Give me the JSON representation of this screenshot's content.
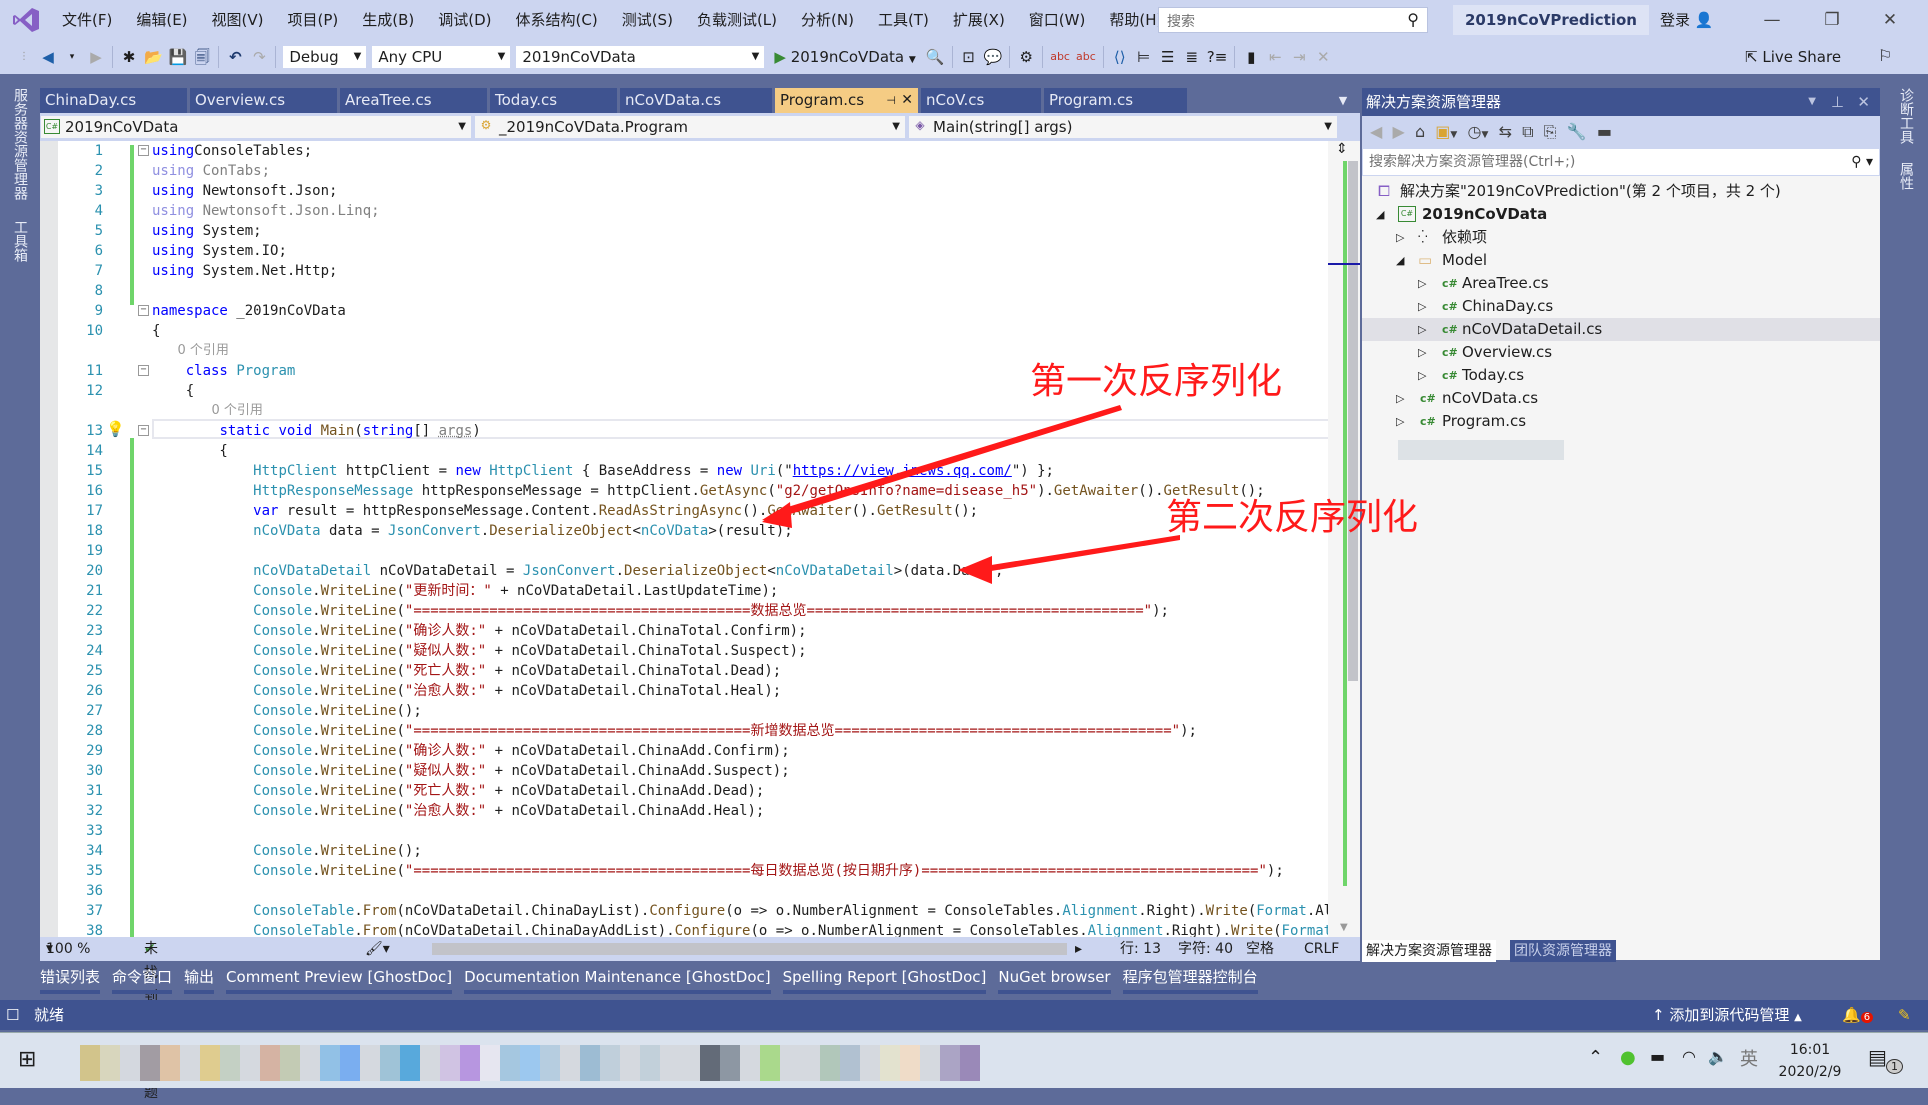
{
  "titlebar": {
    "menus": [
      "文件(F)",
      "编辑(E)",
      "视图(V)",
      "项目(P)",
      "生成(B)",
      "调试(D)",
      "体系结构(C)",
      "测试(S)",
      "负载测试(L)",
      "分析(N)",
      "工具(T)",
      "扩展(X)",
      "窗口(W)",
      "帮助(H)"
    ],
    "search_placeholder": "搜索",
    "solution_name": "2019nCoVPrediction",
    "login": "登录"
  },
  "toolbar": {
    "config": "Debug",
    "platform": "Any CPU",
    "startup_project": "2019nCoVData",
    "run_label": "2019nCoVData",
    "live_share": "Live Share"
  },
  "left_strip": {
    "items": [
      "服务器资源管理器",
      "工具箱"
    ]
  },
  "right_strip": {
    "items": [
      "诊断工具",
      "属性"
    ]
  },
  "tabs": [
    {
      "label": "ChinaDay.cs",
      "active": false
    },
    {
      "label": "Overview.cs",
      "active": false
    },
    {
      "label": "AreaTree.cs",
      "active": false
    },
    {
      "label": "Today.cs",
      "active": false
    },
    {
      "label": "nCoVData.cs",
      "active": false
    },
    {
      "label": "Program.cs",
      "active": true
    },
    {
      "label": "nCoV.cs",
      "active": false
    },
    {
      "label": "Program.cs",
      "active": false
    }
  ],
  "navbar": {
    "project": "2019nCoVData",
    "type": "_2019nCoVData.Program",
    "member": "Main(string[] args)"
  },
  "editor": {
    "lines": [
      {
        "n": "1",
        "tokens": [
          [
            "kw",
            "using"
          ],
          [
            "",
            "ConsoleTables;"
          ]
        ]
      },
      {
        "n": "2",
        "tokens": [
          [
            "gk",
            "using"
          ],
          [
            "gr",
            " ConTabs;"
          ]
        ]
      },
      {
        "n": "3",
        "tokens": [
          [
            "kw",
            "using"
          ],
          [
            "",
            " Newtonsoft.Json;"
          ]
        ]
      },
      {
        "n": "4",
        "tokens": [
          [
            "gk",
            "using"
          ],
          [
            "gr",
            " Newtonsoft.Json.Linq;"
          ]
        ]
      },
      {
        "n": "5",
        "tokens": [
          [
            "kw",
            "using"
          ],
          [
            "",
            " System;"
          ]
        ]
      },
      {
        "n": "6",
        "tokens": [
          [
            "kw",
            "using"
          ],
          [
            "",
            " System.IO;"
          ]
        ]
      },
      {
        "n": "7",
        "tokens": [
          [
            "kw",
            "using"
          ],
          [
            "",
            " System.Net.Http;"
          ]
        ]
      },
      {
        "n": "8",
        "tokens": []
      },
      {
        "n": "9",
        "tokens": [
          [
            "kw",
            "namespace"
          ],
          [
            "",
            " _2019nCoVData"
          ]
        ]
      },
      {
        "n": "10",
        "tokens": [
          [
            "",
            "{"
          ]
        ]
      },
      {
        "lens": "0 个引用",
        "indent": 3
      },
      {
        "n": "11",
        "tokens": [
          [
            "",
            "    "
          ],
          [
            "kw",
            "class"
          ],
          [
            "",
            " "
          ],
          [
            "ty",
            "Program"
          ]
        ]
      },
      {
        "n": "12",
        "tokens": [
          [
            "",
            "    {"
          ]
        ]
      },
      {
        "lens": "0 个引用",
        "indent": 7
      },
      {
        "n": "13",
        "tokens": [
          [
            "",
            "        "
          ],
          [
            "kw",
            "static void"
          ],
          [
            "",
            " "
          ],
          [
            "fn",
            "Main"
          ],
          [
            "",
            "("
          ],
          [
            "kw",
            "string"
          ],
          [
            "",
            "[] "
          ],
          [
            "pm",
            "args"
          ],
          [
            "",
            ")"
          ]
        ]
      },
      {
        "n": "14",
        "tokens": [
          [
            "",
            "        {"
          ]
        ]
      },
      {
        "n": "15",
        "tokens": [
          [
            "",
            "            "
          ],
          [
            "ty",
            "HttpClient"
          ],
          [
            "",
            " httpClient = "
          ],
          [
            "kw",
            "new"
          ],
          [
            "",
            " "
          ],
          [
            "ty",
            "HttpClient"
          ],
          [
            "",
            " { BaseAddress = "
          ],
          [
            "kw",
            "new"
          ],
          [
            "",
            " "
          ],
          [
            "ty",
            "Uri"
          ],
          [
            "",
            "(\""
          ],
          [
            "url",
            "https://view.inews.qq.com/"
          ],
          [
            "",
            "\") };"
          ]
        ]
      },
      {
        "n": "16",
        "tokens": [
          [
            "",
            "            "
          ],
          [
            "ty",
            "HttpResponseMessage"
          ],
          [
            "",
            " httpResponseMessage = httpClient."
          ],
          [
            "fn",
            "GetAsync"
          ],
          [
            "",
            "("
          ],
          [
            "st",
            "\"g2/getOnsInfo?name=disease_h5\""
          ],
          [
            "",
            ")."
          ],
          [
            "fn",
            "GetAwaiter"
          ],
          [
            "",
            "()."
          ],
          [
            "fn",
            "GetResult"
          ],
          [
            "",
            "();"
          ]
        ]
      },
      {
        "n": "17",
        "tokens": [
          [
            "",
            "            "
          ],
          [
            "kw",
            "var"
          ],
          [
            "",
            " result = httpResponseMessage.Content."
          ],
          [
            "fn",
            "ReadAsStringAsync"
          ],
          [
            "",
            "()."
          ],
          [
            "fn",
            "GetAwaiter"
          ],
          [
            "",
            "()."
          ],
          [
            "fn",
            "GetResult"
          ],
          [
            "",
            "();"
          ]
        ]
      },
      {
        "n": "18",
        "tokens": [
          [
            "",
            "            "
          ],
          [
            "ty",
            "nCoVData"
          ],
          [
            "",
            " data = "
          ],
          [
            "ty",
            "JsonConvert"
          ],
          [
            "",
            "."
          ],
          [
            "fn",
            "DeserializeObject"
          ],
          [
            "",
            "<"
          ],
          [
            "ty",
            "nCoVData"
          ],
          [
            "",
            ">(result);"
          ]
        ]
      },
      {
        "n": "19",
        "tokens": []
      },
      {
        "n": "20",
        "tokens": [
          [
            "",
            "            "
          ],
          [
            "ty",
            "nCoVDataDetail"
          ],
          [
            "",
            " nCoVDataDetail = "
          ],
          [
            "ty",
            "JsonConvert"
          ],
          [
            "",
            "."
          ],
          [
            "fn",
            "DeserializeObject"
          ],
          [
            "",
            "<"
          ],
          [
            "ty",
            "nCoVDataDetail"
          ],
          [
            "",
            ">(data.Data);"
          ]
        ]
      },
      {
        "n": "21",
        "tokens": [
          [
            "",
            "            "
          ],
          [
            "ty",
            "Console"
          ],
          [
            "",
            "."
          ],
          [
            "fn",
            "WriteLine"
          ],
          [
            "",
            "("
          ],
          [
            "st",
            "\"更新时间：\""
          ],
          [
            "",
            " + nCoVDataDetail.LastUpdateTime);"
          ]
        ]
      },
      {
        "n": "22",
        "tokens": [
          [
            "",
            "            "
          ],
          [
            "ty",
            "Console"
          ],
          [
            "",
            "."
          ],
          [
            "fn",
            "WriteLine"
          ],
          [
            "",
            "("
          ],
          [
            "st",
            "\"========================================数据总览========================================\""
          ],
          [
            "",
            ");"
          ]
        ]
      },
      {
        "n": "23",
        "tokens": [
          [
            "",
            "            "
          ],
          [
            "ty",
            "Console"
          ],
          [
            "",
            "."
          ],
          [
            "fn",
            "WriteLine"
          ],
          [
            "",
            "("
          ],
          [
            "st",
            "\"确诊人数:\""
          ],
          [
            "",
            " + nCoVDataDetail.ChinaTotal.Confirm);"
          ]
        ]
      },
      {
        "n": "24",
        "tokens": [
          [
            "",
            "            "
          ],
          [
            "ty",
            "Console"
          ],
          [
            "",
            "."
          ],
          [
            "fn",
            "WriteLine"
          ],
          [
            "",
            "("
          ],
          [
            "st",
            "\"疑似人数:\""
          ],
          [
            "",
            " + nCoVDataDetail.ChinaTotal.Suspect);"
          ]
        ]
      },
      {
        "n": "25",
        "tokens": [
          [
            "",
            "            "
          ],
          [
            "ty",
            "Console"
          ],
          [
            "",
            "."
          ],
          [
            "fn",
            "WriteLine"
          ],
          [
            "",
            "("
          ],
          [
            "st",
            "\"死亡人数:\""
          ],
          [
            "",
            " + nCoVDataDetail.ChinaTotal.Dead);"
          ]
        ]
      },
      {
        "n": "26",
        "tokens": [
          [
            "",
            "            "
          ],
          [
            "ty",
            "Console"
          ],
          [
            "",
            "."
          ],
          [
            "fn",
            "WriteLine"
          ],
          [
            "",
            "("
          ],
          [
            "st",
            "\"治愈人数:\""
          ],
          [
            "",
            " + nCoVDataDetail.ChinaTotal.Heal);"
          ]
        ]
      },
      {
        "n": "27",
        "tokens": [
          [
            "",
            "            "
          ],
          [
            "ty",
            "Console"
          ],
          [
            "",
            "."
          ],
          [
            "fn",
            "WriteLine"
          ],
          [
            "",
            "();"
          ]
        ]
      },
      {
        "n": "28",
        "tokens": [
          [
            "",
            "            "
          ],
          [
            "ty",
            "Console"
          ],
          [
            "",
            "."
          ],
          [
            "fn",
            "WriteLine"
          ],
          [
            "",
            "("
          ],
          [
            "st",
            "\"========================================新增数据总览========================================\""
          ],
          [
            "",
            ");"
          ]
        ]
      },
      {
        "n": "29",
        "tokens": [
          [
            "",
            "            "
          ],
          [
            "ty",
            "Console"
          ],
          [
            "",
            "."
          ],
          [
            "fn",
            "WriteLine"
          ],
          [
            "",
            "("
          ],
          [
            "st",
            "\"确诊人数:\""
          ],
          [
            "",
            " + nCoVDataDetail.ChinaAdd.Confirm);"
          ]
        ]
      },
      {
        "n": "30",
        "tokens": [
          [
            "",
            "            "
          ],
          [
            "ty",
            "Console"
          ],
          [
            "",
            "."
          ],
          [
            "fn",
            "WriteLine"
          ],
          [
            "",
            "("
          ],
          [
            "st",
            "\"疑似人数:\""
          ],
          [
            "",
            " + nCoVDataDetail.ChinaAdd.Suspect);"
          ]
        ]
      },
      {
        "n": "31",
        "tokens": [
          [
            "",
            "            "
          ],
          [
            "ty",
            "Console"
          ],
          [
            "",
            "."
          ],
          [
            "fn",
            "WriteLine"
          ],
          [
            "",
            "("
          ],
          [
            "st",
            "\"死亡人数:\""
          ],
          [
            "",
            " + nCoVDataDetail.ChinaAdd.Dead);"
          ]
        ]
      },
      {
        "n": "32",
        "tokens": [
          [
            "",
            "            "
          ],
          [
            "ty",
            "Console"
          ],
          [
            "",
            "."
          ],
          [
            "fn",
            "WriteLine"
          ],
          [
            "",
            "("
          ],
          [
            "st",
            "\"治愈人数:\""
          ],
          [
            "",
            " + nCoVDataDetail.ChinaAdd.Heal);"
          ]
        ]
      },
      {
        "n": "33",
        "tokens": []
      },
      {
        "n": "34",
        "tokens": [
          [
            "",
            "            "
          ],
          [
            "ty",
            "Console"
          ],
          [
            "",
            "."
          ],
          [
            "fn",
            "WriteLine"
          ],
          [
            "",
            "();"
          ]
        ]
      },
      {
        "n": "35",
        "tokens": [
          [
            "",
            "            "
          ],
          [
            "ty",
            "Console"
          ],
          [
            "",
            "."
          ],
          [
            "fn",
            "WriteLine"
          ],
          [
            "",
            "("
          ],
          [
            "st",
            "\"========================================每日数据总览(按日期升序)========================================\""
          ],
          [
            "",
            ");"
          ]
        ]
      },
      {
        "n": "36",
        "tokens": []
      },
      {
        "n": "37",
        "tokens": [
          [
            "",
            "            "
          ],
          [
            "ty",
            "ConsoleTable"
          ],
          [
            "",
            "."
          ],
          [
            "fn",
            "From"
          ],
          [
            "",
            "(nCoVDataDetail.ChinaDayList)."
          ],
          [
            "fn",
            "Configure"
          ],
          [
            "",
            "(o => o.NumberAlignment = ConsoleTables."
          ],
          [
            "ty",
            "Alignment"
          ],
          [
            "",
            ".Right)."
          ],
          [
            "fn",
            "Write"
          ],
          [
            "",
            "("
          ],
          [
            "ty",
            "Format"
          ],
          [
            "",
            ".Alternative);"
          ]
        ]
      },
      {
        "n": "38",
        "tokens": [
          [
            "",
            "            "
          ],
          [
            "ty",
            "ConsoleTable"
          ],
          [
            "",
            "."
          ],
          [
            "fn",
            "From"
          ],
          [
            "",
            "(nCoVDataDetail.ChinaDayAddList)."
          ],
          [
            "fn",
            "Configure"
          ],
          [
            "",
            "(o => o.NumberAlignment = ConsoleTables."
          ],
          [
            "ty",
            "Alignment"
          ],
          [
            "",
            ".Right)."
          ],
          [
            "fn",
            "Write"
          ],
          [
            "",
            "("
          ],
          [
            "ty",
            "Format"
          ],
          [
            "",
            ".Alternative);"
          ]
        ]
      }
    ]
  },
  "annotations": {
    "first": "第一次反序列化",
    "second": "第二次反序列化"
  },
  "editor_status": {
    "zoom": "100 %",
    "issues": "未找到相关问题",
    "line": "行: 13",
    "char": "字符: 40",
    "whitespace": "空格",
    "eol": "CRLF"
  },
  "solution_explorer": {
    "title": "解决方案资源管理器",
    "search_placeholder": "搜索解决方案资源管理器(Ctrl+;)",
    "solution": "解决方案\"2019nCoVPrediction\"(第 2 个项目，共 2 个)",
    "project": "2019nCoVData",
    "deps": "依赖项",
    "folder": "Model",
    "model_files": [
      "AreaTree.cs",
      "ChinaDay.cs",
      "nCoVDataDetail.cs",
      "Overview.cs",
      "Today.cs"
    ],
    "root_files": [
      "nCoVData.cs",
      "Program.cs"
    ],
    "selected": "nCoVDataDetail.cs",
    "bottom_tabs": [
      "解决方案资源管理器",
      "团队资源管理器"
    ]
  },
  "tool_tabs": [
    "错误列表",
    "命令窗口",
    "输出",
    "Comment Preview [GhostDoc]",
    "Documentation Maintenance [GhostDoc]",
    "Spelling Report [GhostDoc]",
    "NuGet browser",
    "程序包管理器控制台"
  ],
  "statusbar": {
    "ready": "就绪",
    "source_control": "添加到源代码管理",
    "notifications": "6"
  },
  "taskbar": {
    "ime": "英",
    "time": "16:01",
    "date": "2020/2/9",
    "action_center_count": "1"
  },
  "colors": {
    "accent": "#3f5390",
    "active_tab": "#f5cc84",
    "annotation": "#ff1a1a"
  }
}
